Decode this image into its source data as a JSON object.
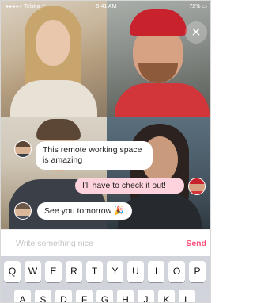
{
  "status_bar": {
    "carrier": "Telstra",
    "time": "9:41 AM",
    "battery": "72%"
  },
  "close_label": "×",
  "messages": [
    {
      "text": "This remote working space is amazing"
    },
    {
      "text": "I'll have to check it out!"
    },
    {
      "text": "See you tomorrow 🎉"
    }
  ],
  "composer": {
    "placeholder": "Write something nice",
    "send_label": "Send"
  },
  "keyboard": {
    "row1": [
      "Q",
      "W",
      "E",
      "R",
      "T",
      "Y",
      "U",
      "I",
      "O",
      "P"
    ],
    "row2": [
      "A",
      "S",
      "D",
      "F",
      "G",
      "H",
      "J",
      "K",
      "L"
    ]
  },
  "colors": {
    "accent": "#ff4f7a",
    "bubble_outgoing": "#ffd3dd",
    "keyboard_bg": "#d1d4da"
  }
}
